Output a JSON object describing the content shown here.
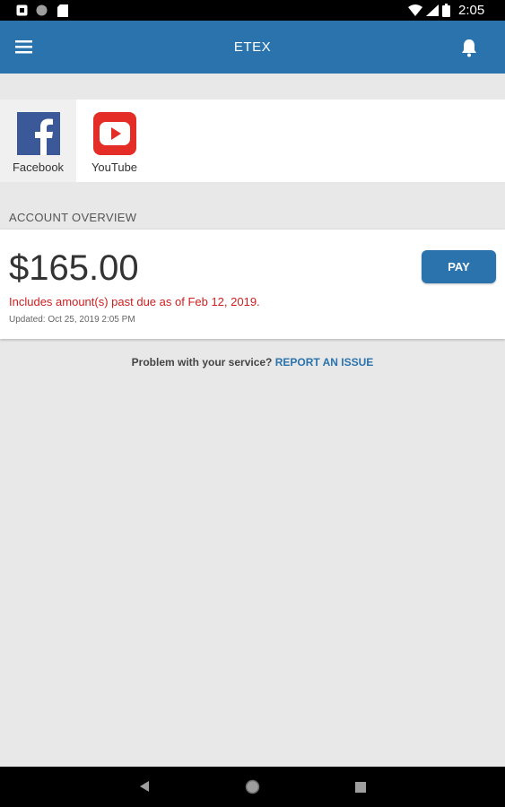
{
  "status_bar": {
    "time": "2:05",
    "icons": [
      "notification-icon",
      "circle-icon",
      "sd-card-icon",
      "wifi-icon",
      "signal-icon",
      "battery-icon"
    ]
  },
  "app_bar": {
    "title": "ETEX",
    "menu_icon": "menu-icon",
    "bell_icon": "bell-icon",
    "background": "#2a73ad"
  },
  "social": {
    "items": [
      {
        "label": "Facebook",
        "icon": "facebook-icon"
      },
      {
        "label": "YouTube",
        "icon": "youtube-icon"
      }
    ]
  },
  "account": {
    "section_title": "ACCOUNT OVERVIEW",
    "balance": "$165.00",
    "past_due": "Includes amount(s) past due as of Feb 12, 2019.",
    "updated": "Updated:  Oct 25, 2019 2:05 PM",
    "pay_label": "PAY"
  },
  "report": {
    "prefix": "Problem with your service?",
    "link": "REPORT AN ISSUE"
  },
  "nav_bar": {
    "icons": [
      "back-icon",
      "home-icon",
      "recent-apps-icon"
    ]
  },
  "colors": {
    "accent": "#2a73ad",
    "warning": "#cc1f1f",
    "background": "#e8e8e8"
  }
}
